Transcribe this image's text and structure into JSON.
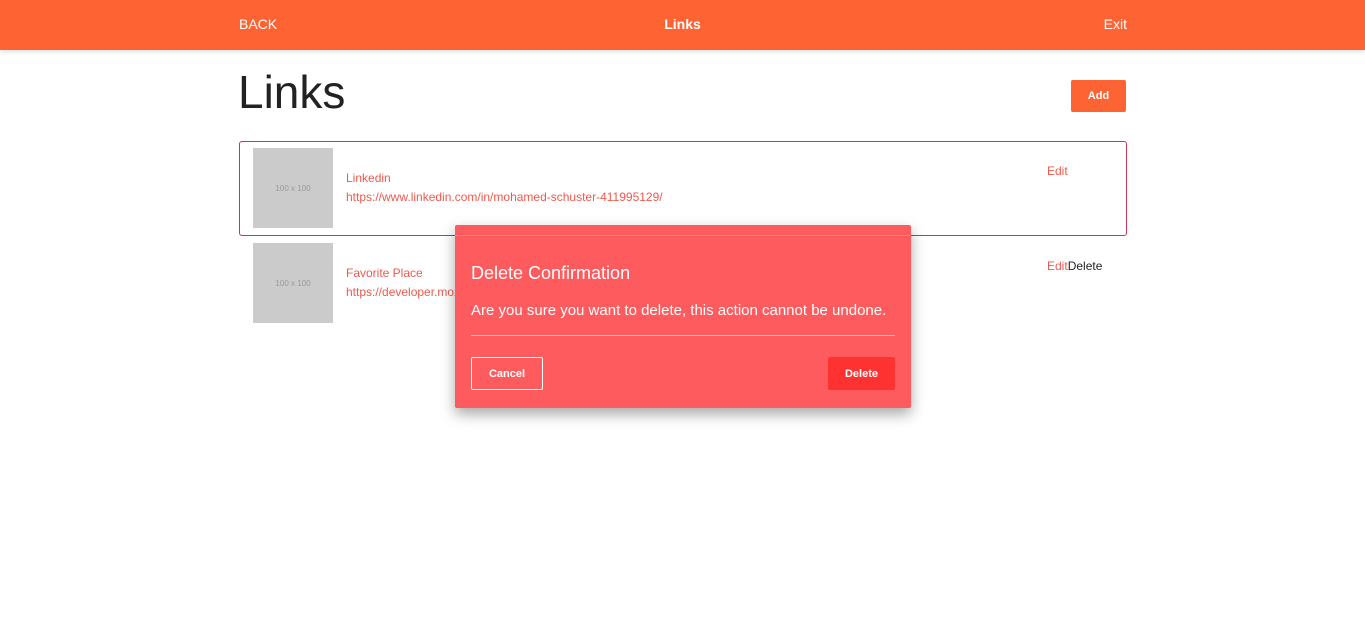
{
  "header": {
    "back_label": "BACK",
    "title": "Links",
    "exit_label": "Exit"
  },
  "page": {
    "title": "Links",
    "add_label": "Add"
  },
  "links": [
    {
      "thumbnail_text": "100 x 100",
      "name": "Linkedin",
      "url": "https://www.linkedin.com/in/mohamed-schuster-411995129/",
      "edit_label": "Edit",
      "delete_label": ""
    },
    {
      "thumbnail_text": "100 x 100",
      "name": "Favorite Place",
      "url": "https://developer.mozilla.org/pt-BR/docs/Web/JavaScript",
      "edit_label": "Edit",
      "delete_label": "Delete"
    }
  ],
  "modal": {
    "heading": "Delete Confirmation",
    "message": "Are you sure you want to delete, this action cannot be undone.",
    "cancel_label": "Cancel",
    "delete_label": "Delete"
  },
  "colors": {
    "accent": "#fd6333",
    "link_text": "#ee5a4e",
    "modal_background": "#fe5b5e",
    "modal_delete_button": "#fe3331",
    "selected_border": "#c9364f"
  }
}
